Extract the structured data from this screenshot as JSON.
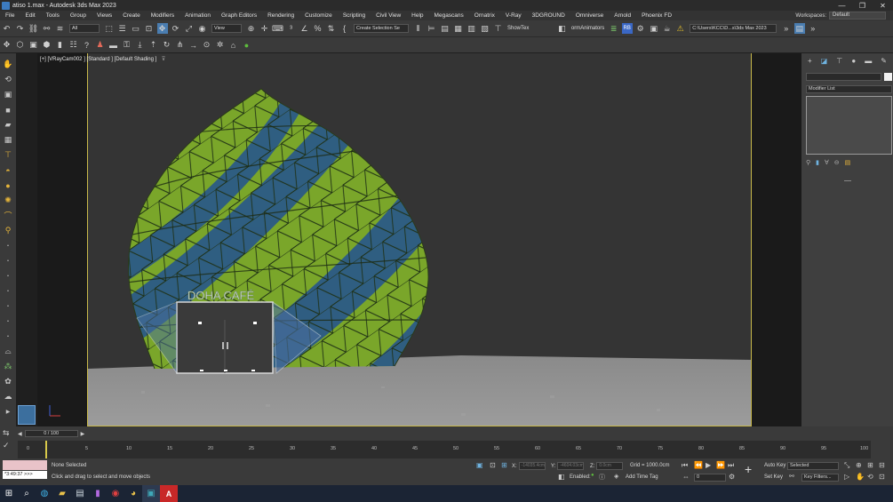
{
  "window": {
    "title": "atiso 1.max - Autodesk 3ds Max 2023",
    "minimize": "—",
    "restore": "❐",
    "close": "✕"
  },
  "menu": {
    "items": [
      "File",
      "Edit",
      "Tools",
      "Group",
      "Views",
      "Create",
      "Modifiers",
      "Animation",
      "Graph Editors",
      "Rendering",
      "Customize",
      "Scripting",
      "Civil View",
      "Help",
      "Megascans",
      "Ornatrix",
      "V-Ray",
      "3DGROUND",
      "Omniverse",
      "Arnold",
      "Phoenix FD"
    ],
    "workspace_label": "Workspaces:",
    "workspace_value": "Default"
  },
  "toolbar": {
    "selection_filter": "All",
    "reference_coord": "View",
    "named_selection": "Create Selection Se",
    "show_tex": "ShowTex",
    "orm_animators": "ormAnimators",
    "rb": "RB",
    "project_path": "C:\\Users\\KCC\\D...s\\3ds Max 2023"
  },
  "viewport": {
    "label": "[+] [VRayCam002 ] [Standard ] [Default Shading ]",
    "filter_icon": "⊽",
    "sign_text": "DOHA CAFÉ"
  },
  "command_panel": {
    "modifier_list": "Modifier List"
  },
  "timeline": {
    "frame_display": "0 / 100",
    "ticks": [
      "0",
      "5",
      "10",
      "15",
      "20",
      "25",
      "30",
      "35",
      "40",
      "45",
      "50",
      "55",
      "60",
      "65",
      "70",
      "75",
      "80",
      "85",
      "90",
      "95",
      "100"
    ]
  },
  "status": {
    "maxscript_time": "*3:49:37 >>>",
    "selection": "None Selected",
    "hint": "Click and drag to select and move objects",
    "x_label": "X:",
    "x_value": "-14035.4cm",
    "y_label": "Y:",
    "y_value": "-4604.03cm",
    "z_label": "Z:",
    "z_value": "0.0cm",
    "grid": "Grid = 1000.0cm",
    "enabled_label": "Enabled:",
    "add_time_tag": "Add Time Tag",
    "frame_value": "0",
    "auto_key": "Auto Key",
    "set_key": "Set Key",
    "key_mode": "Selected",
    "key_filters": "Key Filters..."
  },
  "colors": {
    "dome_green": "#7aa62a",
    "dome_blue": "#2c5a86",
    "safe_frame": "#c8b84a"
  }
}
